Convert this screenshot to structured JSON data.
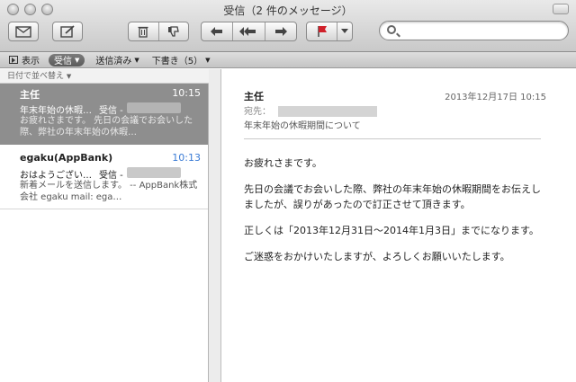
{
  "window": {
    "title": "受信（2 件のメッセージ）"
  },
  "toolbar": {
    "buttons": [
      {
        "name": "get-mail-button",
        "icon": "envelope-icon"
      },
      {
        "name": "compose-button",
        "icon": "compose-icon"
      },
      {
        "name": "delete-button",
        "icon": "trash-icon"
      },
      {
        "name": "junk-button",
        "icon": "thumbs-down-icon"
      },
      {
        "name": "reply-button",
        "icon": "reply-icon"
      },
      {
        "name": "reply-all-button",
        "icon": "reply-all-icon"
      },
      {
        "name": "forward-button",
        "icon": "forward-icon"
      },
      {
        "name": "flag-button",
        "icon": "flag-icon"
      }
    ],
    "search": {
      "placeholder": ""
    }
  },
  "favorites": {
    "show_label": "表示",
    "inbox_label": "受信",
    "sent_label": "送信済み",
    "drafts_label": "下書き（5）"
  },
  "sort": {
    "label": "日付で並べ替え"
  },
  "messages": [
    {
      "from": "主任",
      "time": "10:15",
      "subject": "年末年始の休暇…",
      "mailbox": "受信 -",
      "preview": "お疲れさまです。 先日の会議でお会いした際、弊社の年末年始の休暇…",
      "selected": true
    },
    {
      "from": "egaku(AppBank)",
      "time": "10:13",
      "subject": "おはようござい…",
      "mailbox": "受信 -",
      "preview": "新着メールを送信します。 -- AppBank株式会社 egaku mail: ega…",
      "selected": false
    }
  ],
  "reader": {
    "from": "主任",
    "date": "2013年12月17日 10:15",
    "to_label": "宛先：",
    "subject": "年末年始の休暇期間について",
    "body": [
      "お疲れさまです。",
      "先日の会議でお会いした際、弊社の年末年始の休暇期間をお伝えしましたが、誤りがあったので訂正させて頂きます。",
      "正しくは「2013年12月31日〜2014年1月3日」までになります。",
      "ご迷惑をおかけいたしますが、よろしくお願いいたします。"
    ]
  },
  "colors": {
    "selected_row": "#8e8e8e",
    "time_accent": "#3a7bd5",
    "flag_red": "#d0202a"
  }
}
